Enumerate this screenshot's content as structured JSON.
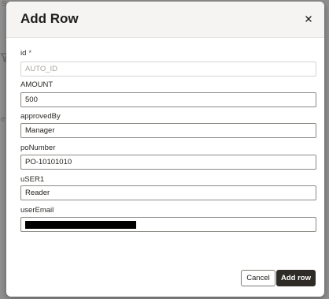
{
  "background": {
    "top_left_text": "Se",
    "side_text": "e"
  },
  "dialog": {
    "title": "Add Row",
    "close_icon": "close-icon",
    "fields": [
      {
        "label": "id",
        "required_marker": "*",
        "placeholder": "AUTO_ID",
        "value": ""
      },
      {
        "label": "AMOUNT",
        "value": "500"
      },
      {
        "label": "approvedBy",
        "value": "Manager"
      },
      {
        "label": "poNumber",
        "value": "PO-10101010"
      },
      {
        "label": "uSER1",
        "value": "Reader"
      },
      {
        "label": "userEmail",
        "value": ""
      }
    ],
    "cancel_label": "Cancel",
    "add_label": "Add row"
  },
  "colors": {
    "primary_button": "#2f2c28",
    "header_bg": "#f5f4f2"
  }
}
